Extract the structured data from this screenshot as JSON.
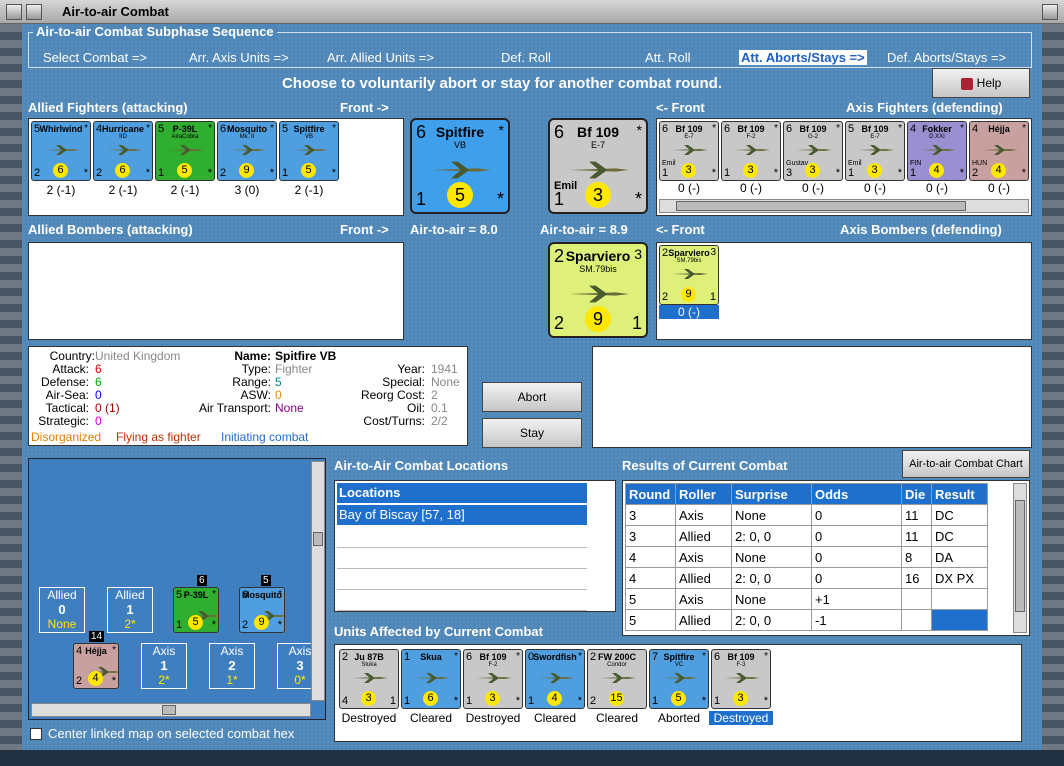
{
  "window": {
    "title": "Air-to-air Combat"
  },
  "sequence": {
    "title": "Air-to-air Combat Subphase Sequence",
    "steps": [
      "Select Combat =>",
      "Arr. Axis Units =>",
      "Arr. Allied Units =>",
      "Def. Roll",
      "Att. Roll",
      "Att. Aborts/Stays =>",
      "Def. Aborts/Stays =>"
    ]
  },
  "instruction": "Choose to voluntarily abort or stay for another combat round.",
  "help_label": "Help",
  "labels": {
    "allied_fighters": "Allied Fighters (attacking)",
    "front_right": "Front ->",
    "front_left": "<- Front",
    "axis_fighters": "Axis Fighters (defending)",
    "allied_bombers": "Allied Bombers (attacking)",
    "axis_bombers": "Axis Bombers (defending)",
    "air_allied": "Air-to-air = 8.0",
    "air_axis": "Air-to-air = 8.9"
  },
  "allied_fighters": [
    {
      "name": "Whirlwind",
      "sub": "",
      "tl": "5",
      "bl": "2",
      "br": "*",
      "ctr": "6",
      "val": "2 (-1)",
      "color": "#4f9fe0"
    },
    {
      "name": "Hurricane",
      "sub": "IID",
      "tl": "4",
      "bl": "2",
      "br": "*",
      "ctr": "6",
      "val": "2 (-1)",
      "color": "#4f9fe0"
    },
    {
      "name": "P-39L",
      "sub": "AiraCobra",
      "tl": "5",
      "bl": "1",
      "br": "*",
      "ctr": "5",
      "val": "2 (-1)",
      "color": "#2fae2f"
    },
    {
      "name": "Mosquito",
      "sub": "Mk. II",
      "tl": "6",
      "bl": "2",
      "br": "*",
      "ctr": "9",
      "val": "3 (0)",
      "color": "#4f9fe0"
    },
    {
      "name": "Spitfire",
      "sub": "VB",
      "tl": "5",
      "bl": "1",
      "br": "*",
      "ctr": "5",
      "val": "2 (-1)",
      "color": "#4f9fe0"
    }
  ],
  "allied_lead": {
    "name": "Spitfire",
    "sub": "VB",
    "tl": "6",
    "bl": "1",
    "br": "*",
    "ctr": "5",
    "color": "#3f9fea"
  },
  "axis_lead": {
    "name": "Bf 109",
    "sub": "E-7",
    "tl": "6",
    "bl": "1",
    "br": "*",
    "ctr": "3",
    "label": "Emil",
    "color": "#c8c8c8"
  },
  "axis_fighters": [
    {
      "name": "Bf 109",
      "sub": "E-7",
      "tl": "6",
      "bl": "1",
      "br": "*",
      "ctr": "3",
      "label": "Emil",
      "val": "0 (-)",
      "color": "#c8c8c8"
    },
    {
      "name": "Bf 109",
      "sub": "F-2",
      "tl": "6",
      "bl": "1",
      "br": "*",
      "ctr": "3",
      "label": "",
      "val": "0 (-)",
      "color": "#c8c8c8"
    },
    {
      "name": "Bf 109",
      "sub": "G-2",
      "tl": "6",
      "bl": "3",
      "br": "*",
      "ctr": "3",
      "label": "Gustav",
      "val": "0 (-)",
      "color": "#c8c8c8"
    },
    {
      "name": "Bf 109",
      "sub": "E-7",
      "tl": "5",
      "bl": "1",
      "br": "*",
      "ctr": "3",
      "label": "Emil",
      "val": "0 (-)",
      "color": "#c8c8c8"
    },
    {
      "name": "Fokker",
      "sub": "D.XXI",
      "tl": "4",
      "bl": "1",
      "br": "*",
      "ctr": "4",
      "label": "FIN",
      "val": "0 (-)",
      "color": "#9a8fd0"
    },
    {
      "name": "Héjja",
      "sub": "",
      "tl": "4",
      "bl": "2",
      "br": "*",
      "ctr": "4",
      "label": "HUN",
      "val": "0 (-)",
      "color": "#c8a0a0"
    }
  ],
  "axis_bomber_lead": {
    "name": "Sparviero",
    "sub": "SM.79bis",
    "tl": "2",
    "tr": "3",
    "bl": "2",
    "br": "1",
    "ctr": "9",
    "color": "#dff07a"
  },
  "axis_bombers": [
    {
      "name": "Sparviero",
      "sub": "SM.79bis",
      "tl": "2",
      "tr": "3",
      "bl": "2",
      "br": "1",
      "ctr": "9",
      "val": "0 (-)",
      "color": "#dff07a"
    }
  ],
  "unit_info": {
    "country_k": "Country:",
    "country_v": "United Kingdom",
    "attack_k": "Attack:",
    "attack_v": "6",
    "defense_k": "Defense:",
    "defense_v": "6",
    "airsea_k": "Air-Sea:",
    "airsea_v": "0",
    "tactical_k": "Tactical:",
    "tactical_v": "0 (1)",
    "strategic_k": "Strategic:",
    "strategic_v": "0",
    "name_k": "Name:",
    "name_v": "Spitfire VB",
    "type_k": "Type:",
    "type_v": "Fighter",
    "range_k": "Range:",
    "range_v": "5",
    "asw_k": "ASW:",
    "asw_v": "0",
    "airtransport_k": "Air Transport:",
    "airtransport_v": "None",
    "year_k": "Year:",
    "year_v": "1941",
    "special_k": "Special:",
    "special_v": "None",
    "reorg_k": "Reorg Cost:",
    "reorg_v": "2",
    "oil_k": "Oil:",
    "oil_v": "0.1",
    "costturns_k": "Cost/Turns:",
    "costturns_v": "2/2",
    "status1": "Disorganized",
    "status2": "Flying as fighter",
    "status3": "Initiating combat"
  },
  "buttons": {
    "abort": "Abort",
    "stay": "Stay",
    "chart": "Air-to-air Combat Chart"
  },
  "locations": {
    "title": "Air-to-Air Combat Locations",
    "header": "Locations",
    "items": [
      "Bay of Biscay [57, 18]"
    ]
  },
  "results": {
    "title": "Results of Current Combat",
    "headers": [
      "Round",
      "Roller",
      "Surprise",
      "Odds",
      "Die",
      "Result"
    ],
    "rows": [
      [
        "3",
        "Axis",
        "None",
        "0",
        "11",
        "DC"
      ],
      [
        "3",
        "Allied",
        "2: 0, 0",
        "0",
        "11",
        "DC"
      ],
      [
        "4",
        "Axis",
        "None",
        "0",
        "8",
        "DA"
      ],
      [
        "4",
        "Allied",
        "2: 0, 0",
        "0",
        "16",
        "DX PX"
      ],
      [
        "5",
        "Axis",
        "None",
        "+1",
        "",
        ""
      ],
      [
        "5",
        "Allied",
        "2: 0, 0",
        "-1",
        "",
        ""
      ]
    ]
  },
  "affected": {
    "title": "Units Affected by Current Combat",
    "units": [
      {
        "name": "Ju 87B",
        "sub": "Stuka",
        "tl": "2",
        "bl": "4",
        "br": "1",
        "ctr": "3",
        "status": "Destroyed",
        "color": "#c8c8c8"
      },
      {
        "name": "Skua",
        "sub": "",
        "tl": "1",
        "bl": "1",
        "br": "*",
        "ctr": "6",
        "status": "Cleared",
        "color": "#4f9fe0"
      },
      {
        "name": "Bf 109",
        "sub": "F-2",
        "tl": "6",
        "bl": "1",
        "br": "*",
        "ctr": "3",
        "status": "Destroyed",
        "color": "#c8c8c8"
      },
      {
        "name": "Swordfish",
        "sub": "",
        "tl": "0",
        "bl": "1",
        "br": "*",
        "ctr": "4",
        "status": "Cleared",
        "color": "#4f9fe0"
      },
      {
        "name": "FW 200C",
        "sub": "Condor",
        "tl": "2",
        "bl": "2",
        "br": "",
        "ctr": "15",
        "status": "Cleared",
        "color": "#c8c8c8"
      },
      {
        "name": "Spitfire",
        "sub": "VC",
        "tl": "7",
        "bl": "1",
        "br": "*",
        "ctr": "5",
        "status": "Aborted",
        "color": "#4f9fe0"
      },
      {
        "name": "Bf 109",
        "sub": "F-3",
        "tl": "6",
        "bl": "1",
        "br": "*",
        "ctr": "3",
        "status": "Destroyed",
        "color": "#c8c8c8"
      }
    ]
  },
  "map": {
    "chips": [
      {
        "side": "Allied",
        "num": "0",
        "note": "None"
      },
      {
        "side": "Allied",
        "num": "1",
        "note": "2*"
      },
      {
        "side": "Axis",
        "num": "1",
        "note": "2*"
      },
      {
        "side": "Axis",
        "num": "2",
        "note": "1*"
      },
      {
        "side": "Axis",
        "num": "3",
        "note": "0*"
      }
    ],
    "stack_counts": [
      "6",
      "5",
      "14"
    ],
    "units": [
      {
        "name": "P-39L",
        "tl": "5",
        "bl": "1",
        "ctr": "5",
        "color": "#2fae2f"
      },
      {
        "name": "Mosquito",
        "tl": "6",
        "bl": "2",
        "ctr": "9",
        "color": "#4f9fe0"
      },
      {
        "name": "Héjja",
        "tl": "4",
        "bl": "2",
        "ctr": "4",
        "color": "#c8a0a0"
      }
    ],
    "checkbox_label": "Center linked map on selected combat hex"
  }
}
